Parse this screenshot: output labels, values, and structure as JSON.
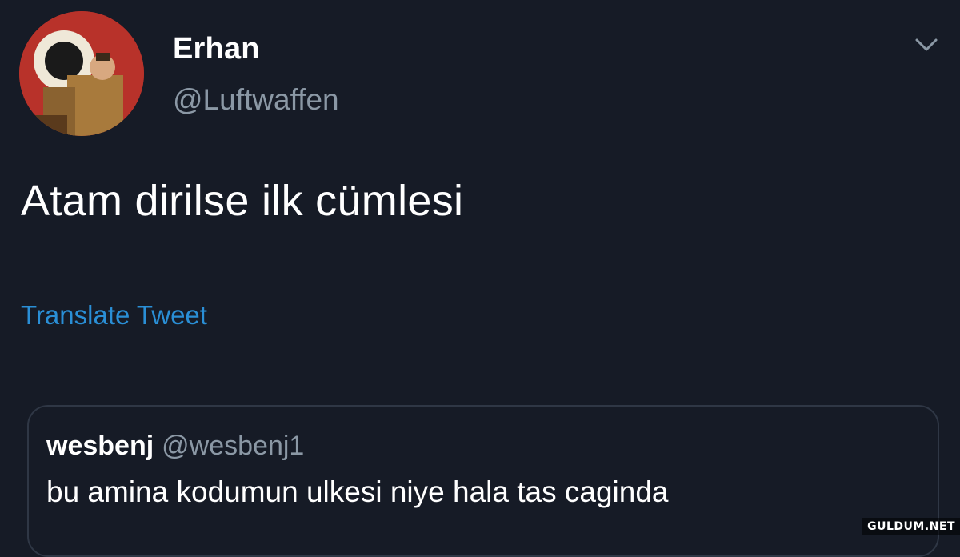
{
  "tweet": {
    "author": {
      "display_name": "Erhan",
      "handle": "@Luftwaffen",
      "avatar_icon": "profile-photo"
    },
    "text": "Atam dirilse ilk cümlesi",
    "translate_label": "Translate Tweet",
    "menu_icon": "chevron-down-icon",
    "quoted": {
      "display_name": "wesbenj",
      "handle": "@wesbenj1",
      "text": "bu amina kodumun ulkesi niye hala tas caginda"
    }
  },
  "watermark": "GULDUM.NET",
  "colors": {
    "background": "#161b26",
    "primary_text": "#ffffff",
    "secondary_text": "#8b98a5",
    "link": "#2a8fd6",
    "border": "#2f3745"
  }
}
